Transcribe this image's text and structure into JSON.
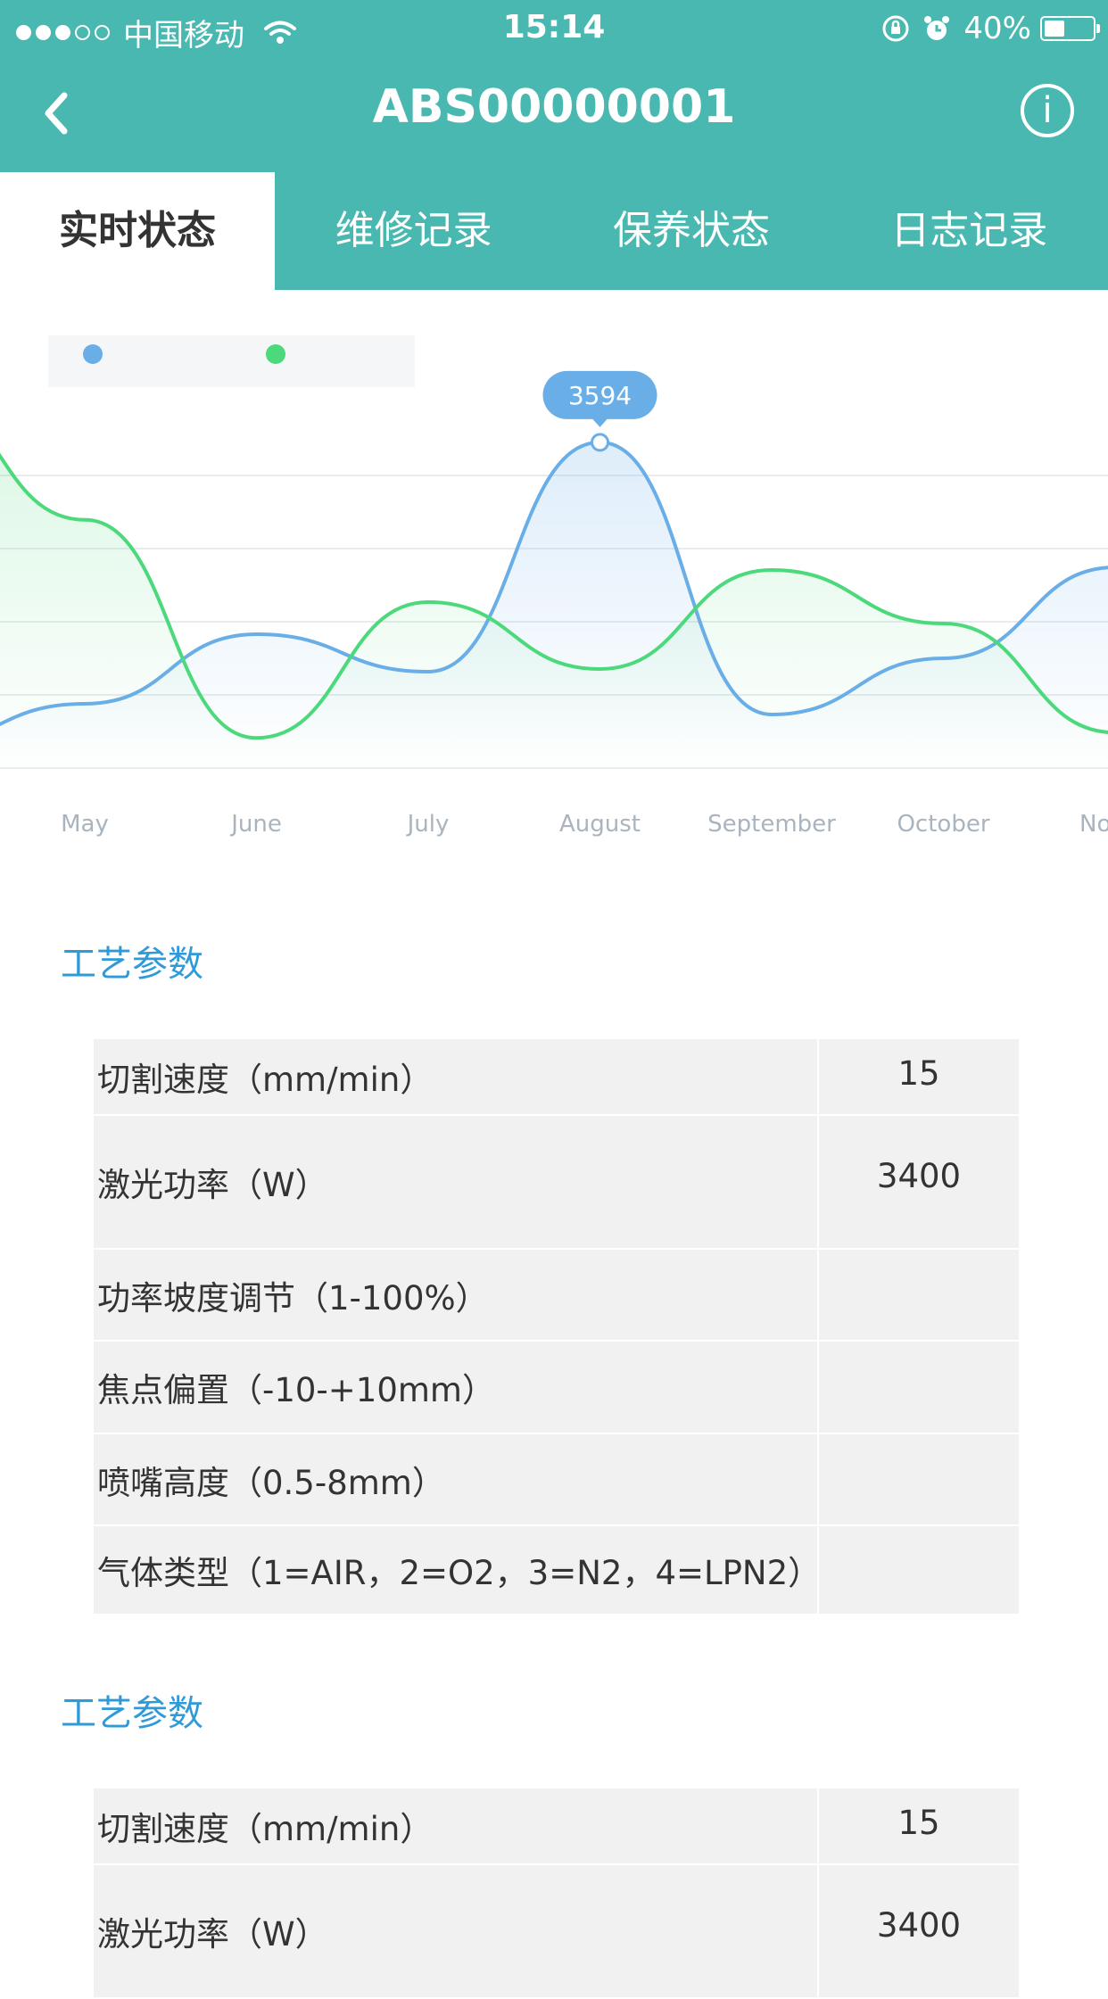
{
  "status_bar": {
    "carrier": "中国移动",
    "time": "15:14",
    "battery": "40%"
  },
  "header": {
    "title": "ABS00000001"
  },
  "tabs": [
    {
      "label": "实时状态",
      "active": true
    },
    {
      "label": "维修记录",
      "active": false
    },
    {
      "label": "保养状态",
      "active": false
    },
    {
      "label": "日志记录",
      "active": false
    }
  ],
  "chart_data": {
    "type": "line",
    "categories": [
      "May",
      "June",
      "July",
      "August",
      "September",
      "October",
      "Nov"
    ],
    "series": [
      {
        "color": "#6aaee8",
        "values": [
          1640,
          2160,
          1880,
          3594,
          1560,
          1980,
          2660
        ]
      },
      {
        "color": "#4cd97b",
        "values": [
          3015,
          1385,
          2400,
          1900,
          2640,
          2240,
          1425
        ]
      }
    ],
    "tooltip": "3594",
    "grid": true
  },
  "colors": {
    "primary": "#48b8b0",
    "section_title": "#2f9ad8",
    "series_blue": "#6aaee8",
    "series_green": "#4cd97b"
  },
  "sections": [
    {
      "title": "工艺参数",
      "rows": [
        {
          "label": "切割速度（mm/min）",
          "value": "15"
        },
        {
          "label": "激光功率（W）",
          "value": "3400"
        },
        {
          "label": "功率坡度调节（1-100%）",
          "value": ""
        },
        {
          "label": "焦点偏置（-10-+10mm）",
          "value": ""
        },
        {
          "label": "喷嘴高度（0.5-8mm）",
          "value": ""
        },
        {
          "label": "气体类型（1=AIR，2=O2，3=N2，4=LPN2）",
          "value": ""
        }
      ]
    },
    {
      "title": "工艺参数",
      "rows": [
        {
          "label": "切割速度（mm/min）",
          "value": "15"
        },
        {
          "label": "激光功率（W）",
          "value": "3400"
        }
      ]
    }
  ]
}
